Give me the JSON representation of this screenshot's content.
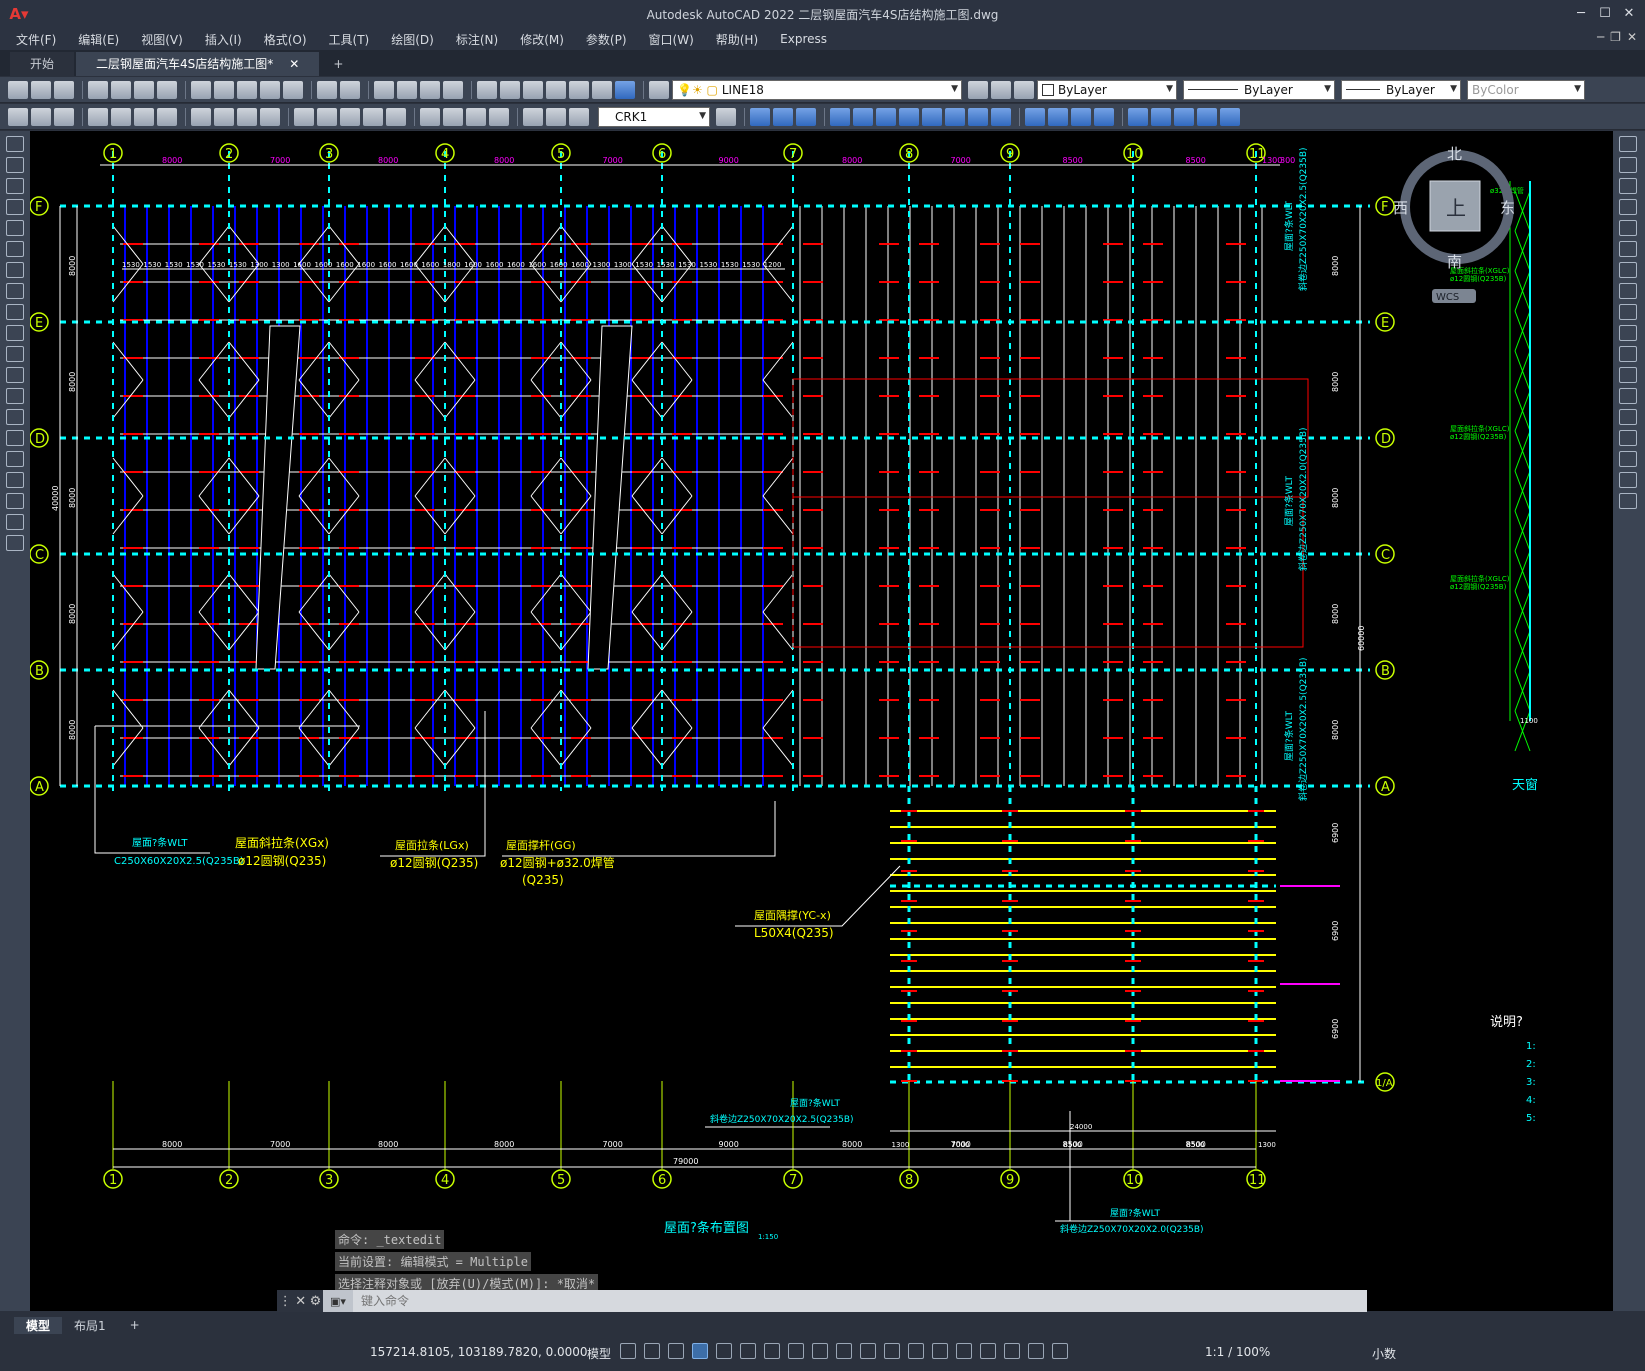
{
  "app": {
    "logo": "A",
    "title": "Autodesk AutoCAD 2022    二层钢屋面汽车4S店结构施工图.dwg"
  },
  "menu": [
    "文件(F)",
    "编辑(E)",
    "视图(V)",
    "插入(I)",
    "格式(O)",
    "工具(T)",
    "绘图(D)",
    "标注(N)",
    "修改(M)",
    "参数(P)",
    "窗口(W)",
    "帮助(H)",
    "Express"
  ],
  "tabs": {
    "start": "开始",
    "doc": "二层钢屋面汽车4S店结构施工图*",
    "add": "+"
  },
  "toolbar": {
    "layer": "LINE18",
    "color": "ByLayer",
    "linetype": "ByLayer",
    "lineweight": "ByLayer",
    "plotstyle": "ByColor",
    "dimstyle": "CRK1"
  },
  "viewcube": {
    "north": "北",
    "south": "南",
    "east": "东",
    "west": "西",
    "face": "上",
    "wcs": "WCS"
  },
  "drawing": {
    "grid_top": [
      "1",
      "2",
      "3",
      "4",
      "5",
      "6",
      "7",
      "8",
      "9",
      "10",
      "11"
    ],
    "grid_rows": [
      "F",
      "E",
      "D",
      "C",
      "B",
      "A",
      "1/A"
    ],
    "top_dims": [
      "8000",
      "7000",
      "8000",
      "8000",
      "7000",
      "9000",
      "8000",
      "7000",
      "8500",
      "8500",
      "1300",
      "300"
    ],
    "bottom_dims": [
      "8000",
      "7000",
      "8000",
      "8000",
      "7000",
      "9000",
      "8000",
      "7000",
      "8500",
      "8500"
    ],
    "bottom_total": "79000",
    "purlin_spacing": [
      "1530",
      "1530",
      "1530",
      "1530",
      "1530",
      "1530",
      "1300",
      "1300",
      "1600",
      "1600",
      "1600",
      "1600",
      "1600",
      "1600",
      "1600",
      "1800",
      "1600",
      "1600",
      "1600",
      "1600",
      "1600",
      "1600",
      "1300",
      "1300",
      "1530",
      "1530",
      "1530",
      "1530",
      "1530",
      "1530",
      "1200"
    ],
    "left_dims": [
      "8000",
      "8000",
      "8000",
      "8000",
      "8000"
    ],
    "left_total": "40000",
    "right_total": "60000",
    "right_dims": [
      "8000",
      "8000",
      "8000",
      "8000",
      "8000"
    ],
    "lower_right_dims": [
      "6900",
      "6900",
      "6900"
    ],
    "bottom_sub_dims": [
      "1300",
      "7000",
      "8500",
      "8500",
      "1300"
    ],
    "bottom_sub_total": "24000",
    "label_purlin_title": "屋面?条WLT",
    "label_purlin_spec": "C250X60X20X2.5(Q235B)",
    "label_tie_title": "屋面斜拉条(XGx)",
    "label_tie_spec": "ø12圆钢(Q235)",
    "label_rod_title": "屋面拉条(LGx)",
    "label_rod_spec": "ø12圆钢(Q235)",
    "label_brace_title": "屋面撑杆(GG)",
    "label_brace_spec": "ø12圆钢+ø32.0焊管",
    "label_brace_spec2": "(Q235)",
    "label_yc_title": "屋面隅撑(YC-x)",
    "label_yc_spec": "L50X4(Q235)",
    "label_right1_title": "屋面?条WLT",
    "label_right1_spec": "斜卷边Z250X70X20X2.5(Q235B)",
    "label_right2_title": "屋面?条WLT",
    "label_right2_spec": "斜卷边Z250X70X20X2.0(Q235B)",
    "label_bottom1_title": "屋面?条WLT",
    "label_bottom1_spec": "斜卷边Z250X70X20X2.5(Q235B)",
    "label_bottom2_title": "屋面?条WLT",
    "label_bottom2_spec": "斜卷边Z250X70X20X2.0(Q235B)",
    "plan_title": "屋面?条布置图",
    "plan_scale": "1:150",
    "note_title": "说明?",
    "notes": [
      "1:",
      "2:",
      "3:",
      "4:",
      "5:"
    ],
    "skylight": "天窗",
    "edge_label1": "ø32.0焊管",
    "edge_label2": "1100",
    "edge_small": [
      "屋面斜拉条(XGLC)",
      "ø12圆钢(Q235B)"
    ]
  },
  "command": {
    "history": [
      "命令: _textedit",
      "当前设置: 编辑模式 = Multiple",
      "选择注释对象或 [放弃(U)/模式(M)]: *取消*"
    ],
    "placeholder": "键入命令"
  },
  "layout_tabs": [
    "模型",
    "布局1",
    "+"
  ],
  "status": {
    "coords": "157214.8105, 103189.7820, 0.0000",
    "model": "模型",
    "scale": "1:1 / 100%",
    "units": "小数"
  },
  "colors": {
    "background": "#000000",
    "grid_bubble": "#c8ff00",
    "axis": "#00ffff",
    "purlin_blue": "#0000ff",
    "purlin_white": "#ffffff",
    "red": "#ff0000",
    "yellow": "#ffff00",
    "magenta": "#ff00ff",
    "green": "#00ff00"
  }
}
